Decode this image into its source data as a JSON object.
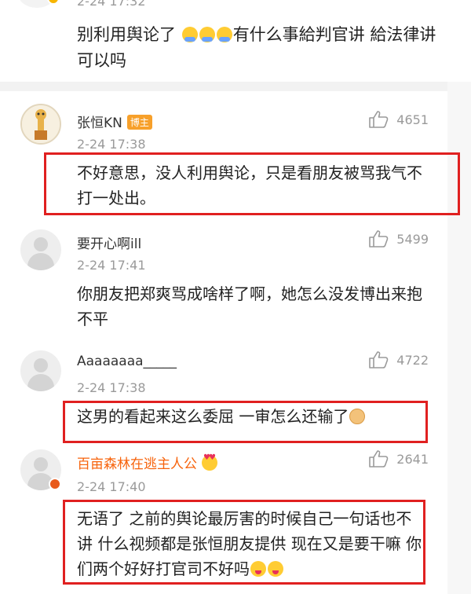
{
  "top_post": {
    "date": "2-24 17:32",
    "text_part1": "别利用舆论了",
    "text_part2": "有什么事給判官讲 給法律讲可以吗"
  },
  "comments": [
    {
      "name": "张恒KN",
      "badge": "博主",
      "date": "2-24 17:38",
      "likes": "4651",
      "text": "不好意思，没人利用舆论，只是看朋友被骂我气不打一处出。"
    },
    {
      "name": "要开心啊ill",
      "date": "2-24 17:41",
      "likes": "5499",
      "text": "你朋友把郑爽骂成啥样了啊，她怎么没发博出来抱不平"
    },
    {
      "name": "Aaaaaaaa_____",
      "date": "2-24 17:38",
      "likes": "4722",
      "text": "这男的看起来这么委屈 一审怎么还输了"
    },
    {
      "name": "百亩森林在逃主人公",
      "date": "2-24 17:40",
      "likes": "2641",
      "text": "无语了 之前的舆论最厉害的时候自己一句话也不讲 什么视频都是张恒朋友提供 现在又是要干嘛 你们两个好好打官司不好吗"
    }
  ],
  "icons": {
    "like": "thumbs-up-icon",
    "verified": "verified-badge-icon",
    "emoji_hug": "hugging-face-emoji",
    "emoji_dog": "doge-emoji",
    "emoji_hearts": "heart-eyes-emoji",
    "emoji_yum": "yum-face-emoji"
  },
  "colors": {
    "highlight": "#e02020",
    "orange_name": "#f7630c",
    "bozhu_badge": "#f7a02a",
    "meta_gray": "#9a9a9a"
  }
}
